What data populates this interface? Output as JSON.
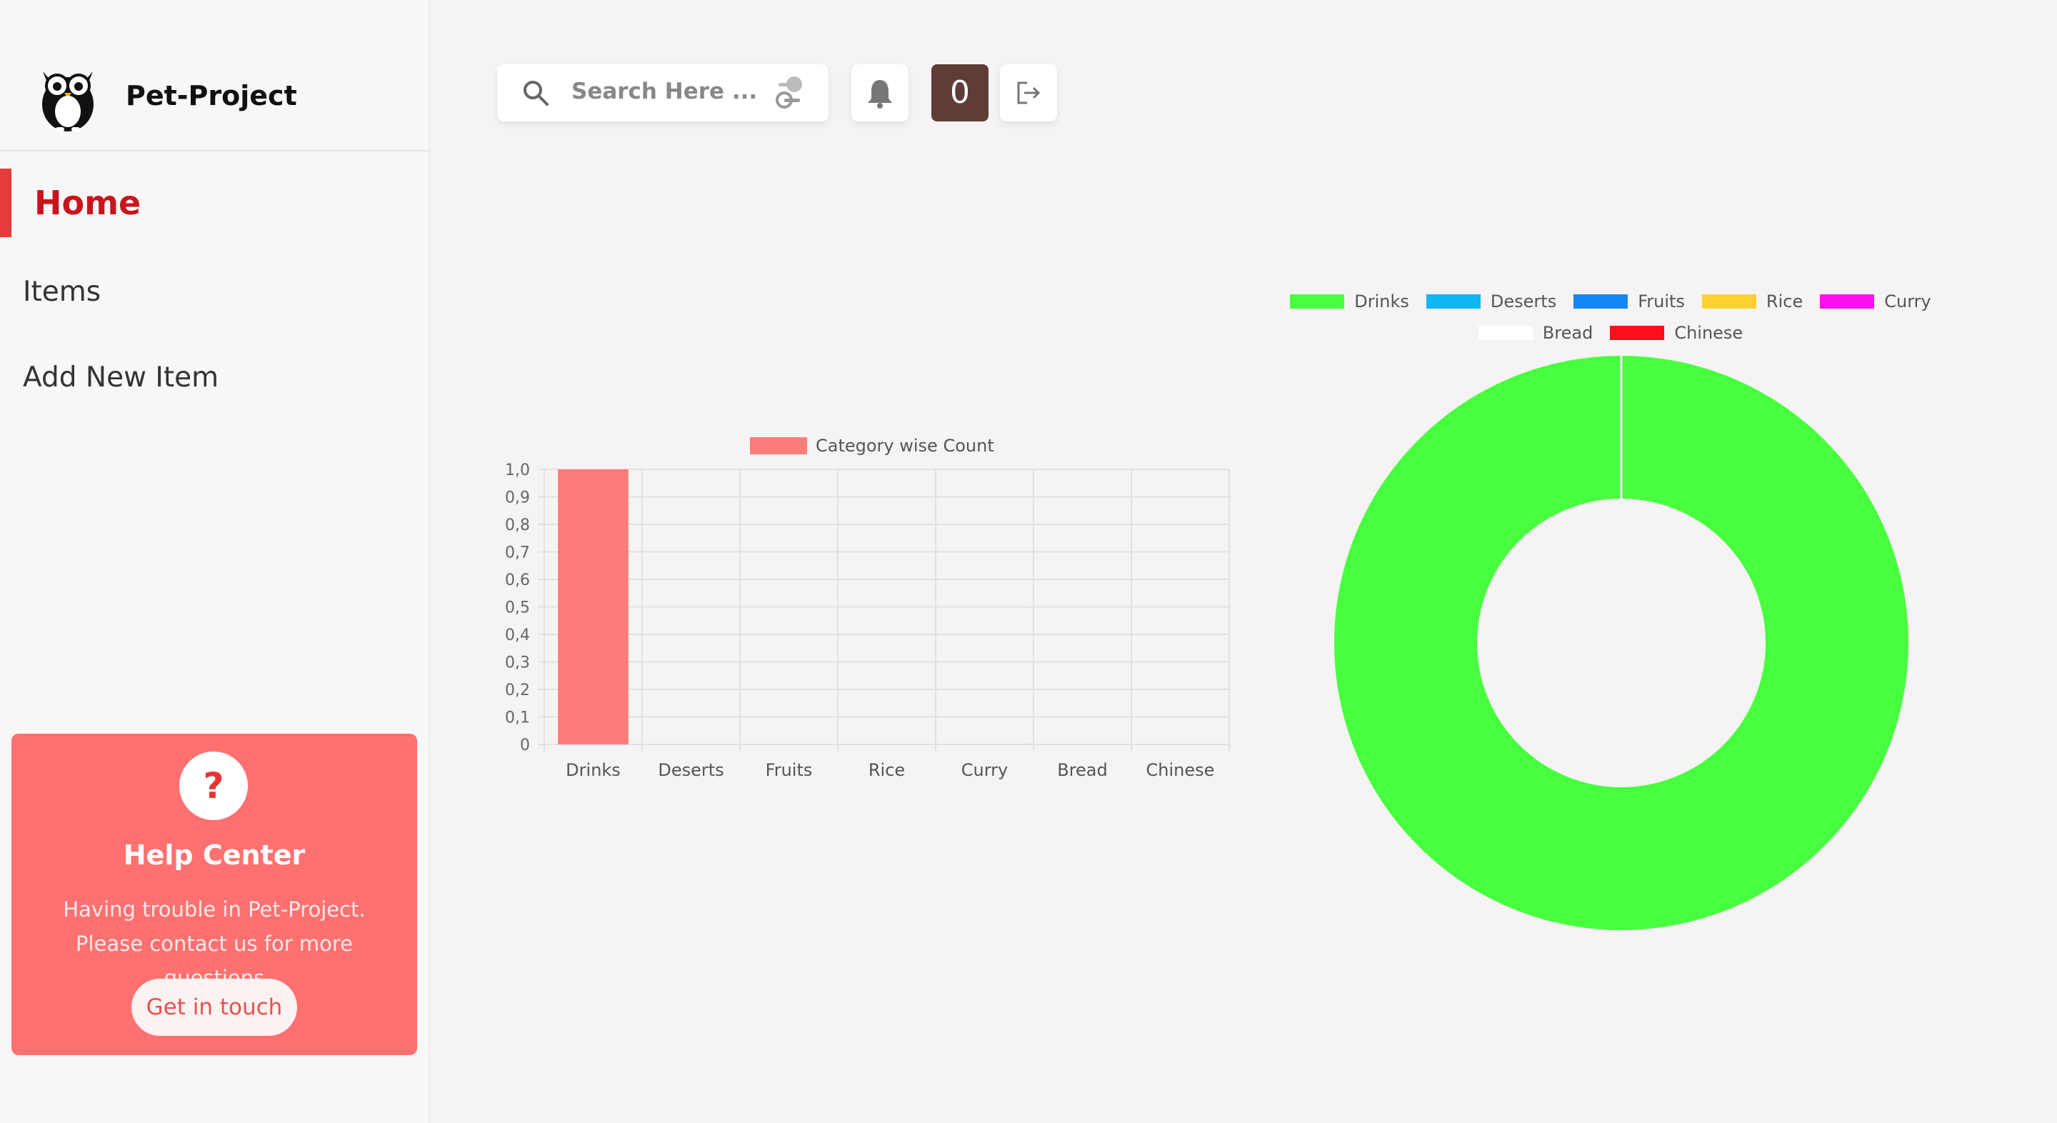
{
  "brand": {
    "name": "Pet-Project",
    "logo_icon": "owl-icon"
  },
  "nav": {
    "home": "Home",
    "items": "Items",
    "add_new_item": "Add New Item"
  },
  "help": {
    "icon": "question-icon",
    "title": "Help Center",
    "text": "Having trouble in Pet-Project. Please contact us for more questions",
    "button": "Get in touch"
  },
  "topbar": {
    "search_placeholder": "Search Here ...",
    "search_icon": "search-icon",
    "filter_icon": "filter-toggle-icon",
    "bell_icon": "bell-icon",
    "counter": "0",
    "logout_icon": "logout-icon"
  },
  "colors": {
    "accent": "#c9141c",
    "help_bg": "#fe7170",
    "counter_bg": "#5e3d36",
    "bar": "#fe7c7b"
  },
  "chart_data": [
    {
      "type": "bar",
      "categories": [
        "Drinks",
        "Deserts",
        "Fruits",
        "Rice",
        "Curry",
        "Bread",
        "Chinese"
      ],
      "series": [
        {
          "name": "Category wise Count",
          "values": [
            1,
            0,
            0,
            0,
            0,
            0,
            0
          ]
        }
      ],
      "yticks": [
        "0",
        "0,1",
        "0,2",
        "0,3",
        "0,4",
        "0,5",
        "0,6",
        "0,7",
        "0,8",
        "0,9",
        "1,0"
      ],
      "ylim": [
        0,
        1
      ],
      "grid": true,
      "legend": "top"
    },
    {
      "type": "pie",
      "categories": [
        "Drinks",
        "Deserts",
        "Fruits",
        "Rice",
        "Curry",
        "Bread",
        "Chinese"
      ],
      "values": [
        1,
        0,
        0,
        0,
        0,
        0,
        0
      ],
      "colors": [
        "#47ff3e",
        "#10b6f4",
        "#1188f3",
        "#ffd031",
        "#ff11f0",
        "#ffffff",
        "#f9101c"
      ],
      "legend": "top"
    }
  ]
}
